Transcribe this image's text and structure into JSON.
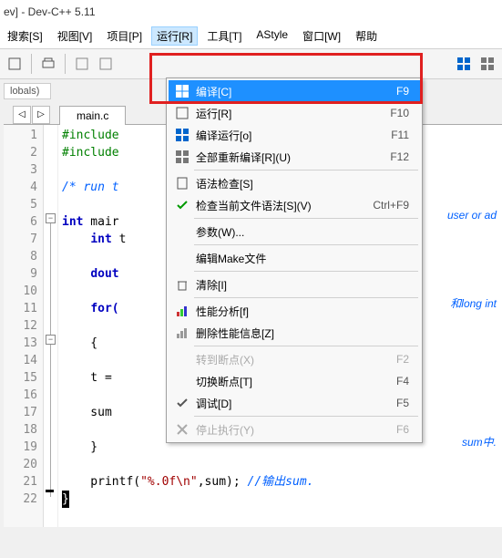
{
  "title": "ev] - Dev-C++ 5.11",
  "menubar": {
    "items": [
      "搜索[S]",
      "视图[V]",
      "项目[P]",
      "运行[R]",
      "工具[T]",
      "AStyle",
      "窗口[W]",
      "帮助"
    ],
    "activeIndex": 3
  },
  "globals_label": "lobals)",
  "nav": {
    "prev": "◁",
    "next": "▷"
  },
  "tab": {
    "label": "main.c"
  },
  "dropdown": {
    "items": [
      {
        "icon": "grid",
        "label": "编译[C]",
        "key": "F9",
        "sel": true
      },
      {
        "icon": "run",
        "label": "运行[R]",
        "key": "F10"
      },
      {
        "icon": "grid2",
        "label": "编译运行[o]",
        "key": "F11"
      },
      {
        "icon": "grid3",
        "label": "全部重新编译[R](U)",
        "key": "F12"
      },
      {
        "sep": true
      },
      {
        "icon": "doc",
        "label": "语法检查[S]",
        "key": ""
      },
      {
        "icon": "check",
        "label": "检查当前文件语法[S](V)",
        "key": "Ctrl+F9"
      },
      {
        "sep": true
      },
      {
        "icon": "",
        "label": "参数(W)...",
        "key": ""
      },
      {
        "sep": true
      },
      {
        "icon": "",
        "label": "编辑Make文件",
        "key": ""
      },
      {
        "sep": true
      },
      {
        "icon": "trash",
        "label": "清除[I]",
        "key": ""
      },
      {
        "sep": true
      },
      {
        "icon": "bar",
        "label": "性能分析[f]",
        "key": ""
      },
      {
        "icon": "barx",
        "label": "删除性能信息[Z]",
        "key": ""
      },
      {
        "sep": true
      },
      {
        "icon": "",
        "label": "转到断点(X)",
        "key": "F2",
        "disabled": true
      },
      {
        "icon": "",
        "label": "切换断点[T]",
        "key": "F4"
      },
      {
        "icon": "check2",
        "label": "调试[D]",
        "key": "F5"
      },
      {
        "sep": true
      },
      {
        "icon": "x",
        "label": "停止执行(Y)",
        "key": "F6",
        "disabled": true
      }
    ]
  },
  "code": {
    "lines": [
      {
        "n": 1,
        "type": "inc",
        "t": "#include"
      },
      {
        "n": 2,
        "type": "inc",
        "t": "#include"
      },
      {
        "n": 3,
        "type": "blank",
        "t": ""
      },
      {
        "n": 4,
        "type": "com",
        "t": "/* run t",
        "tail": "user or ad"
      },
      {
        "n": 5,
        "type": "blank",
        "t": ""
      },
      {
        "n": 6,
        "type": "kw",
        "t": "int",
        "rest": " mair"
      },
      {
        "n": 7,
        "type": "kw2",
        "t": "    int",
        "rest": " t"
      },
      {
        "n": 8,
        "type": "blank",
        "t": ""
      },
      {
        "n": 9,
        "type": "kw2",
        "t": "    dout",
        "tail": "和long int"
      },
      {
        "n": 10,
        "type": "blank",
        "t": ""
      },
      {
        "n": 11,
        "type": "kw2",
        "t": "    for(",
        "rest": ""
      },
      {
        "n": 12,
        "type": "blank",
        "t": ""
      },
      {
        "n": 13,
        "type": "plain",
        "t": "    {"
      },
      {
        "n": 14,
        "type": "blank",
        "t": ""
      },
      {
        "n": 15,
        "type": "plain",
        "t": "    t ="
      },
      {
        "n": 16,
        "type": "blank",
        "t": ""
      },
      {
        "n": 17,
        "type": "plain",
        "t": "    sum",
        "tail": "sum中."
      },
      {
        "n": 18,
        "type": "blank",
        "t": ""
      },
      {
        "n": 19,
        "type": "plain",
        "t": "    }"
      },
      {
        "n": 20,
        "type": "blank",
        "t": ""
      },
      {
        "n": 21,
        "type": "printf",
        "pre": "    printf(",
        "str": "\"%.0f\\n\"",
        "post": ",sum); ",
        "com": "//输出sum."
      },
      {
        "n": 22,
        "type": "end",
        "t": "}"
      }
    ]
  }
}
